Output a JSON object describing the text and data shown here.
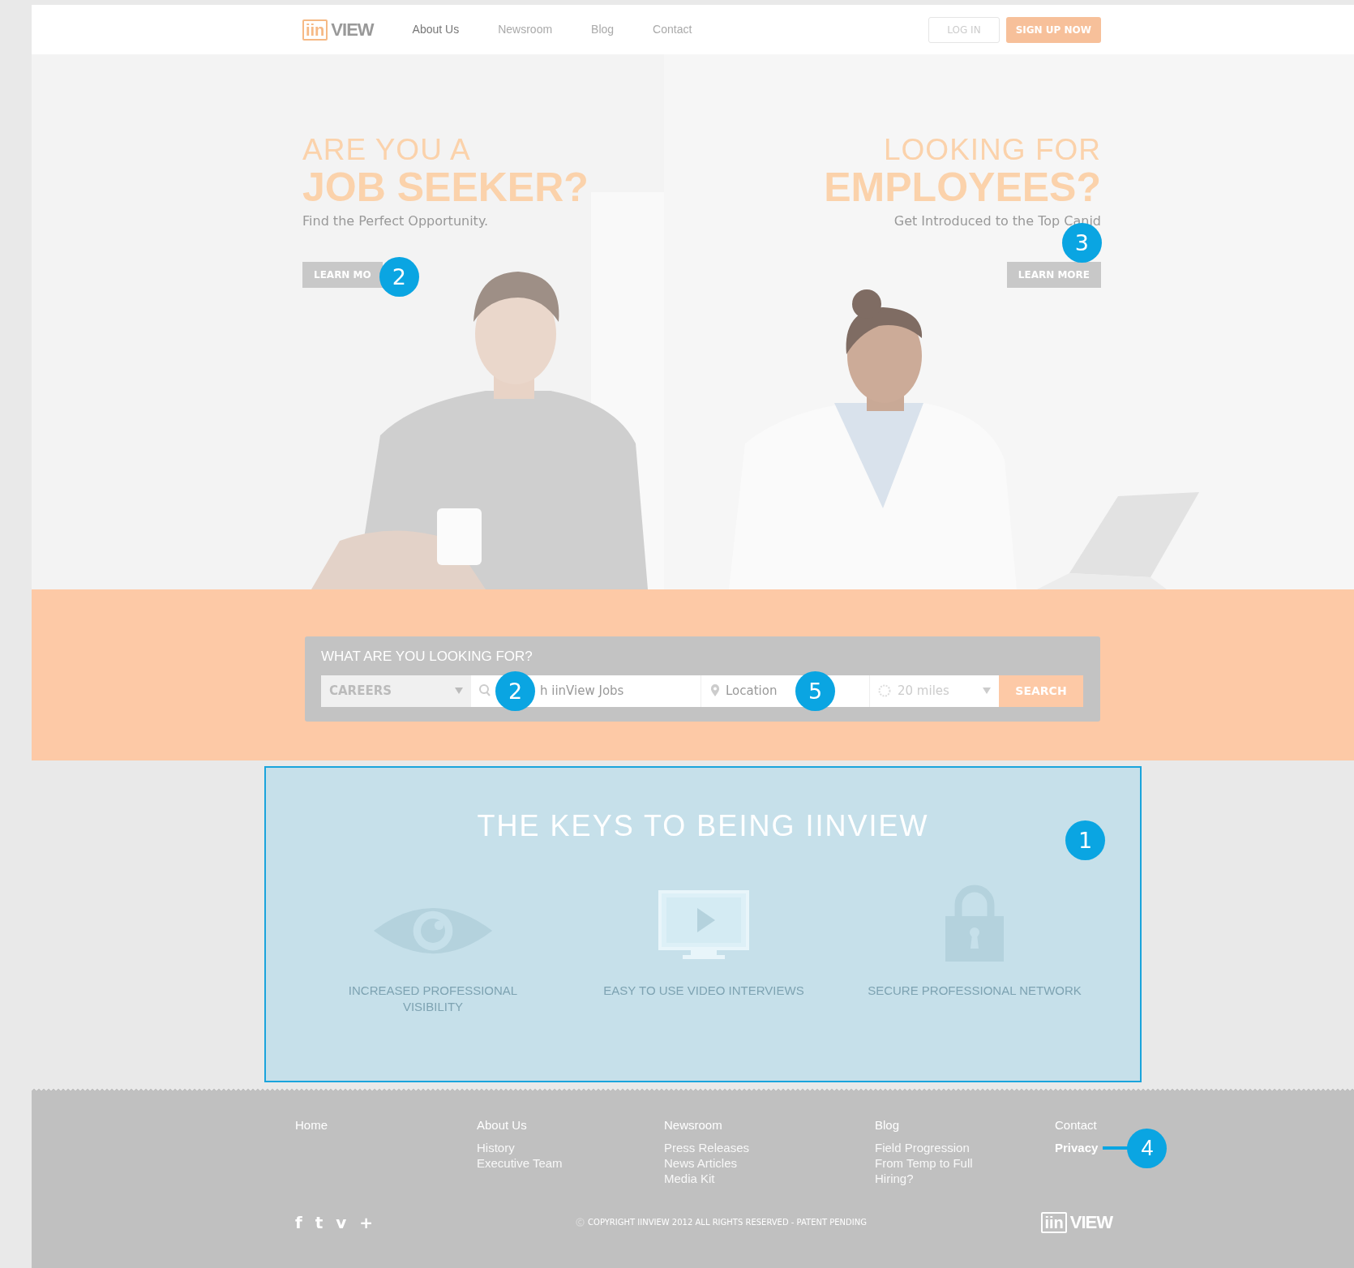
{
  "nav": {
    "logo_mark": "iin",
    "logo_word": "VIEW",
    "links": [
      {
        "label": "About Us",
        "selected": true
      },
      {
        "label": "Newsroom",
        "selected": false
      },
      {
        "label": "Blog",
        "selected": false
      },
      {
        "label": "Contact",
        "selected": false
      }
    ],
    "login": "LOG IN",
    "signup": "SIGN UP NOW"
  },
  "hero": {
    "left": {
      "line1": "ARE YOU A",
      "line2": "JOB SEEKER?",
      "sub": "Find the Perfect Opportunity.",
      "button": "LEARN MO",
      "callout": "2"
    },
    "right": {
      "line1": "LOOKING FOR",
      "line2": "EMPLOYEES?",
      "sub": "Get Introduced to the Top Canid",
      "button": "LEARN MORE",
      "callout": "3"
    }
  },
  "search": {
    "title": "WHAT ARE YOU LOOKING FOR?",
    "category": "CAREERS",
    "keywords_placeholder": "h iinView Jobs",
    "keywords_callout": "2",
    "location_placeholder": "Location",
    "location_callout": "5",
    "radius": "20 miles",
    "button": "SEARCH"
  },
  "keys": {
    "highlighted": true,
    "callout": "1",
    "title": "THE KEYS TO BEING IINVIEW",
    "features": [
      {
        "kind": "eye",
        "label": "INCREASED PROFESSIONAL VISIBILITY"
      },
      {
        "kind": "video",
        "label": "EASY TO USE VIDEO INTERVIEWS"
      },
      {
        "kind": "lock",
        "label": "SECURE PROFESSIONAL NETWORK"
      }
    ]
  },
  "footer": {
    "columns": [
      {
        "heading": "Home"
      },
      {
        "heading": "About Us",
        "links": [
          {
            "label": "History",
            "emphasized": false
          },
          {
            "label": "Executive Team",
            "emphasized": false
          }
        ]
      },
      {
        "heading": "Newsroom",
        "links": [
          {
            "label": "Press Releases",
            "emphasized": false
          },
          {
            "label": "News Articles",
            "emphasized": false
          },
          {
            "label": "Media Kit",
            "emphasized": false
          }
        ]
      },
      {
        "heading": "Blog",
        "links": [
          {
            "label": "Field Progression",
            "emphasized": false
          },
          {
            "label": "From Temp to Full",
            "emphasized": false
          },
          {
            "label": "Hiring?",
            "emphasized": false
          }
        ]
      },
      {
        "heading": "Contact",
        "links": [
          {
            "label": "Privacy",
            "emphasized": true,
            "callout": "4"
          }
        ]
      }
    ],
    "social": [
      "f",
      "t",
      "v",
      "+"
    ],
    "copyright": "COPYRIGHT IINVIEW 2012 ALL RIGHTS RESERVED - PATENT PENDING",
    "logo_mark": "iin",
    "logo_word": "VIEW"
  }
}
